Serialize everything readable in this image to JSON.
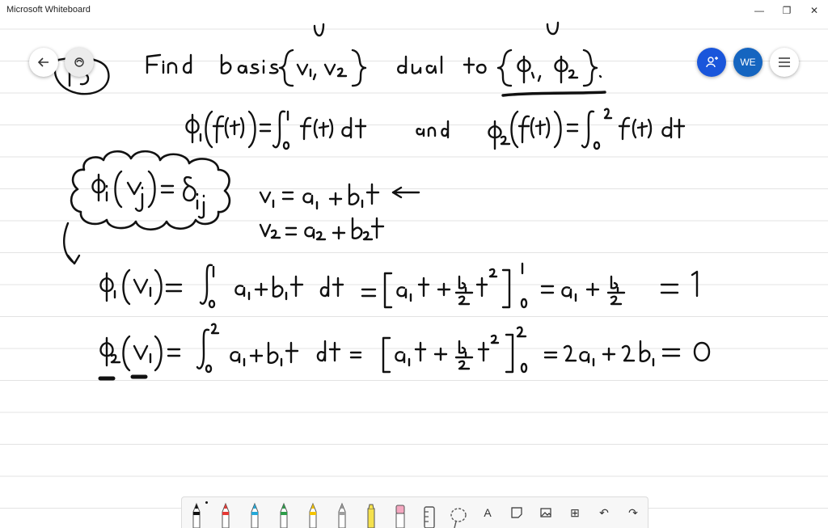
{
  "window": {
    "title": "Microsoft Whiteboard",
    "minimize_glyph": "—",
    "restore_glyph": "❐",
    "close_glyph": "✕"
  },
  "nav": {
    "back_icon": "back-arrow-icon",
    "settings_icon": "ink-settings-icon"
  },
  "collab": {
    "invite_icon": "add-person-icon",
    "user_initials": "WE",
    "menu_icon": "hamburger-menu-icon",
    "accent": "#1a56db",
    "user_color": "#1565c0"
  },
  "toolbar": {
    "tools": [
      {
        "name": "pen-black",
        "color": "#111111"
      },
      {
        "name": "pen-red",
        "color": "#e53935"
      },
      {
        "name": "pen-cyan",
        "color": "#26a9d8"
      },
      {
        "name": "pen-green",
        "color": "#2e9d4a"
      },
      {
        "name": "pen-yellow",
        "color": "#f5c400"
      },
      {
        "name": "pen-gray",
        "color": "#9e9e9e"
      },
      {
        "name": "highlighter",
        "color": "#f5e14d"
      },
      {
        "name": "eraser",
        "color": "#f4a7c0"
      },
      {
        "name": "ruler",
        "color": "#555555"
      },
      {
        "name": "lasso",
        "color": "#555555"
      }
    ],
    "text_glyph": "A",
    "sticky_note_icon": "sticky-note-icon",
    "image_icon": "image-icon",
    "insert_glyph": "⊞",
    "undo_glyph": "↶",
    "redo_glyph": "↷"
  },
  "board": {
    "line_color": "#e3e3e3",
    "ink_color": "#111111"
  }
}
